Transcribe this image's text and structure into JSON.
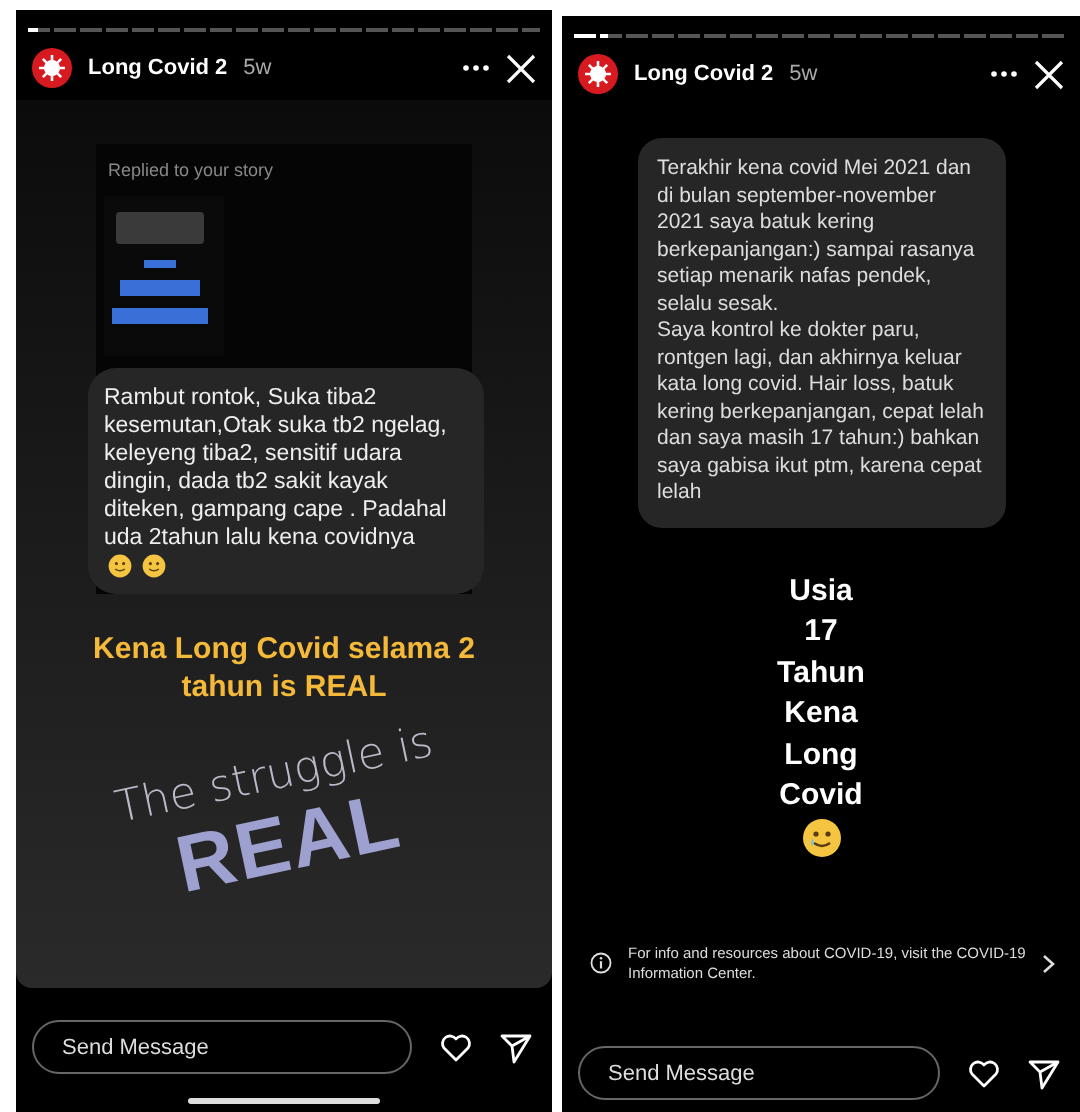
{
  "stories": [
    {
      "kind": "reply",
      "account": {
        "name": "Long Covid 2",
        "time": "5w"
      },
      "progress": {
        "level": 0.02
      },
      "reply_label": "Replied to your story",
      "message": "Rambut rontok, Suka tiba2 kesemutan,Otak suka tb2 ngelag, keleyeng tiba2, sensitif udara dingin, dada tb2 sakit kayak diteken, gampang cape  . Padahal uda 2tahun lalu kena covidnya",
      "caption": "Kena Long Covid selama 2 tahun is REAL",
      "sticker": {
        "line_1": "The struggle is",
        "line_2": "REAL"
      },
      "composer": {
        "placeholder": "Send Message"
      }
    },
    {
      "kind": "text",
      "account": {
        "name": "Long Covid 2",
        "time": "5w"
      },
      "progress": {
        "level": 0.07
      },
      "message": "Terakhir kena covid Mei 2021 dan di bulan september-november 2021 saya batuk kering berkepanjangan:) sampai rasanya setiap menarik nafas pendek, selalu sesak.\nSaya kontrol ke dokter paru, rontgen lagi, dan akhirnya keluar kata long covid. Hair loss, batuk kering berkepanjangan, cepat lelah dan saya masih 17 tahun:) bahkan saya gabisa ikut ptm, karena cepat lelah",
      "big_text": [
        "Usia",
        "17",
        "Tahun",
        "Kena",
        "Long",
        "Covid"
      ],
      "info": "For info and resources about COVID-19, visit the COVID-19 Information Center.",
      "composer": {
        "placeholder": "Send Message"
      }
    }
  ]
}
